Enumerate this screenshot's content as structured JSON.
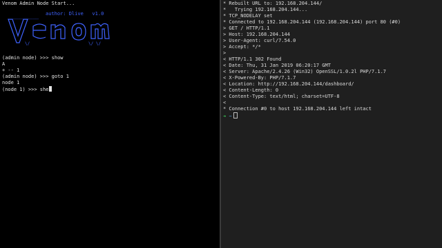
{
  "left_terminal": {
    "header": "Venom Admin Node Start...",
    "author": "author: Dlive   v1.0",
    "logo_text": "Venom",
    "lines": [
      "(admin node) >>> show",
      "A",
      "+ -- 1",
      "(admin node) >>> goto 1",
      "node 1"
    ],
    "prompt": "(node 1) >>> ",
    "input": "she",
    "logo_color": "#3f63ff"
  },
  "right_terminal": {
    "lines": [
      "* Rebuilt URL to: 192.168.204.144/",
      "*   Trying 192.168.204.144...",
      "* TCP_NODELAY set",
      "* Connected to 192.168.204.144 (192.168.204.144) port 80 (#0)",
      "> GET / HTTP/1.1",
      "> Host: 192.168.204.144",
      "> User-Agent: curl/7.54.0",
      "> Accept: */*",
      ">",
      "< HTTP/1.1 302 Found",
      "< Date: Thu, 31 Jan 2019 06:20:17 GMT",
      "< Server: Apache/2.4.26 (Win32) OpenSSL/1.0.2l PHP/7.1.7",
      "< X-Powered-By: PHP/7.1.7",
      "< Location: http://192.168.204.144/dashboard/",
      "< Content-Length: 0",
      "< Content-Type: text/html; charset=UTF-8",
      "<",
      "* Connection #0 to host 192.168.204.144 left intact"
    ],
    "prompt_arrow": "➜",
    "prompt_dir": "~",
    "accent_color": "#3fd15a"
  }
}
